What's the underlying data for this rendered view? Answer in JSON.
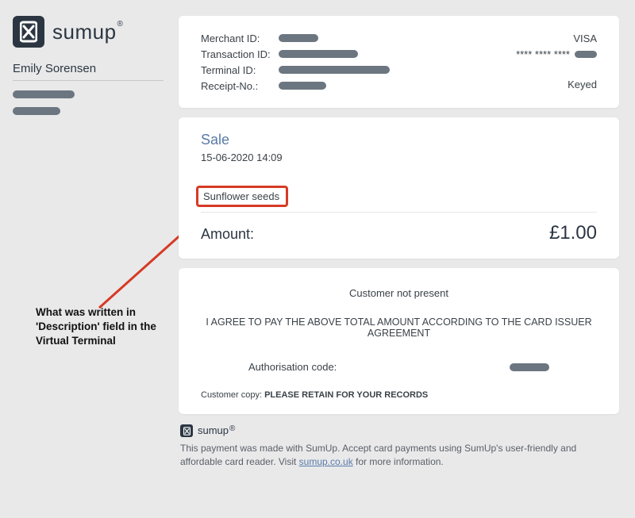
{
  "brand": {
    "name": "sumup",
    "reg": "®"
  },
  "user": {
    "name": "Emily Sorensen"
  },
  "info": {
    "labels": {
      "merchant": "Merchant ID:",
      "transaction": "Transaction ID:",
      "terminal": "Terminal ID:",
      "receipt": "Receipt-No.:"
    },
    "card_brand": "VISA",
    "masked": "**** **** ****",
    "entry": "Keyed"
  },
  "sale": {
    "title": "Sale",
    "datetime": "15-06-2020 14:09",
    "description": "Sunflower seeds",
    "amount_label": "Amount:",
    "amount_value": "£1.00"
  },
  "agree": {
    "cnp": "Customer not present",
    "text": "I AGREE TO PAY THE ABOVE TOTAL AMOUNT ACCORDING TO THE CARD ISSUER AGREEMENT",
    "auth_label": "Authorisation code:",
    "retain_pre": "Customer copy: ",
    "retain_msg": "PLEASE RETAIN FOR YOUR RECORDS"
  },
  "footer": {
    "text_pre": "This payment was made with SumUp. Accept card payments using SumUp's user-friendly and affordable card reader. Visit ",
    "link": "sumup.co.uk",
    "text_post": " for more information."
  },
  "annotation": "What was written in 'Description' field in the Virtual Terminal"
}
